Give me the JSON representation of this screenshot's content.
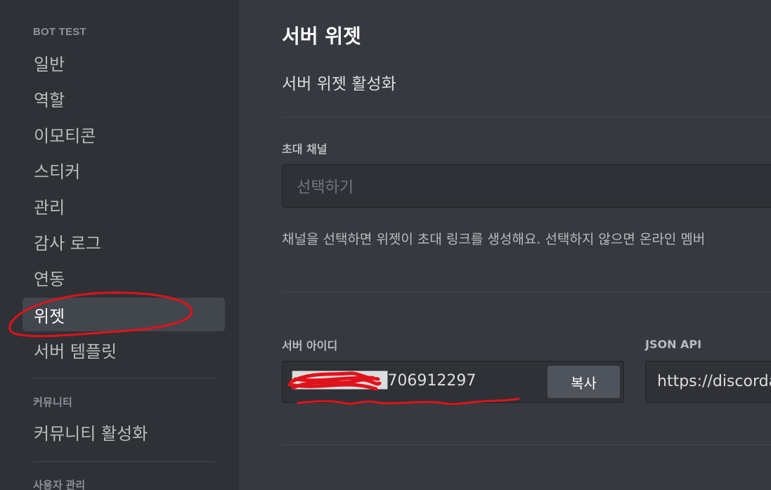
{
  "sidebar": {
    "server_section": "BOT TEST",
    "items": [
      "일반",
      "역할",
      "이모티콘",
      "스티커",
      "관리",
      "감사 로그",
      "연동",
      "위젯",
      "서버 템플릿"
    ],
    "active_item": "위젯",
    "community_section": "커뮤니티",
    "community_items": [
      "커뮤니티 활성화"
    ],
    "user_section": "사용자 관리"
  },
  "main": {
    "title": "서버 위젯",
    "toggle_label": "서버 위젯 활성화",
    "invite_channel_label": "초대 채널",
    "invite_channel_placeholder": "선택하기",
    "help_text": "채널을 선택하면 위젯이 초대 링크를 생성해요. 선택하지 않으면 온라인 멤버",
    "server_id_label": "서버 아이디",
    "server_id_value": "████████706912297",
    "copy_button": "복사",
    "json_api_label": "JSON API",
    "json_api_value": "https://discorda"
  },
  "colors": {
    "sidebar_bg": "#2f3136",
    "main_bg": "#36393f",
    "active_item_bg": "#42464d",
    "annotation_red": "#e0121b"
  }
}
